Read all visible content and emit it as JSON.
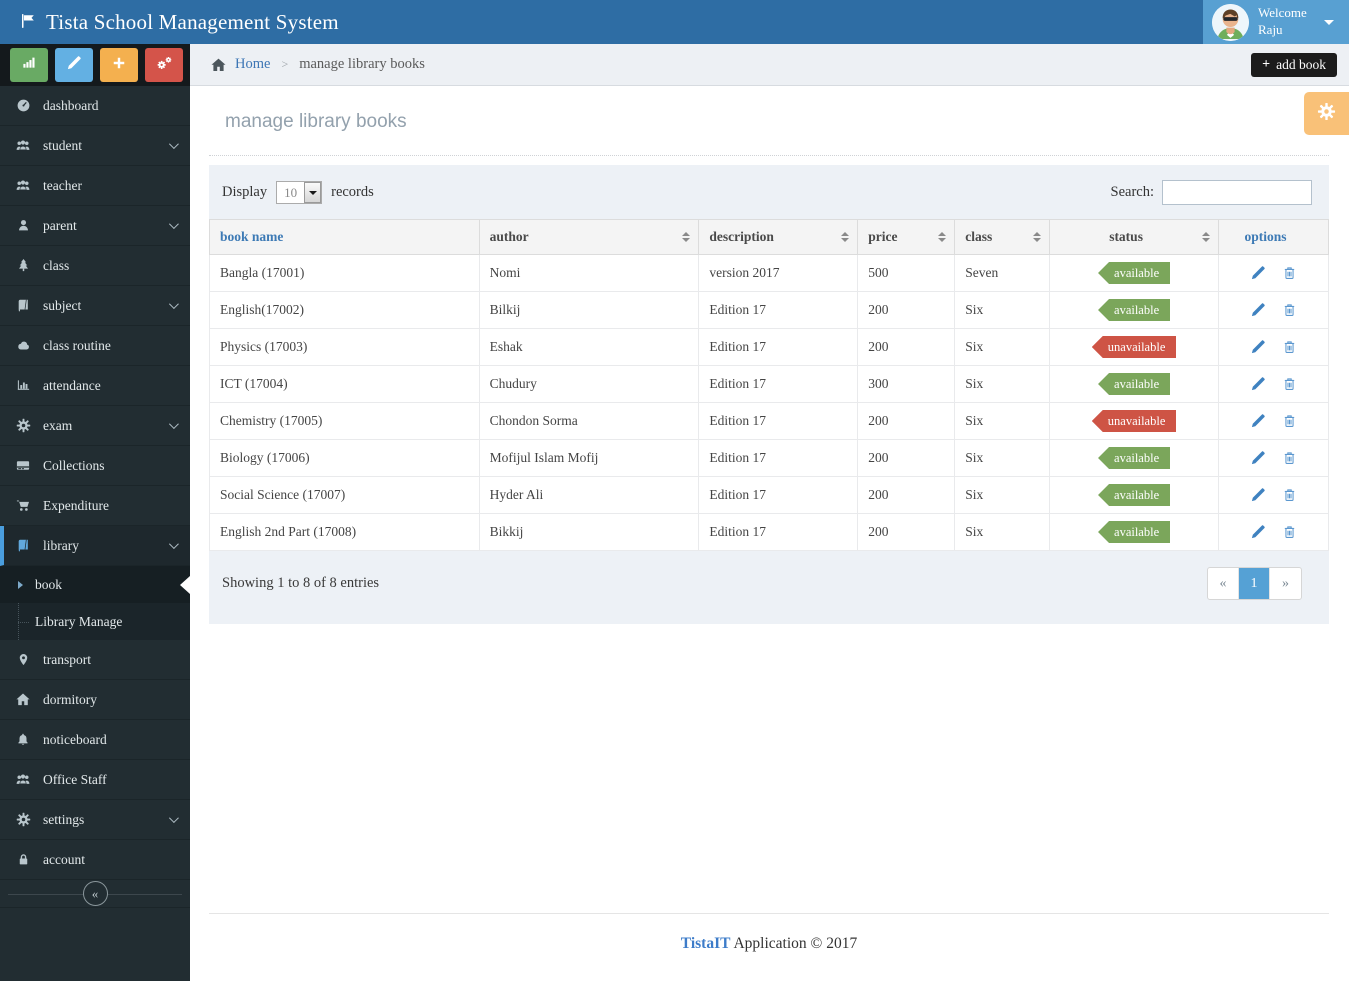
{
  "app": {
    "title": "Tista School Management System",
    "welcome_label": "Welcome",
    "username": "Raju"
  },
  "quickbar": {
    "buttons": [
      {
        "icon": "signal-bars-icon",
        "color": "#69aa64"
      },
      {
        "icon": "pencil-icon",
        "color": "#63b0e3"
      },
      {
        "icon": "plus-icon",
        "color": "#f4b04f"
      },
      {
        "icon": "gears-icon",
        "color": "#d4544a"
      }
    ]
  },
  "breadcrumb": {
    "home": "Home",
    "separator": ">",
    "current": "manage library books"
  },
  "actions": {
    "add_book": "add book",
    "add_book_plus": "+"
  },
  "page": {
    "heading": "manage library books"
  },
  "toolbar": {
    "display_label": "Display",
    "page_size": "10",
    "records_label": "records",
    "search_label": "Search:",
    "search_value": ""
  },
  "table": {
    "columns": [
      {
        "label": "book name",
        "sortable": false,
        "accent": true
      },
      {
        "label": "author",
        "sortable": true,
        "accent": false
      },
      {
        "label": "description",
        "sortable": true,
        "accent": false
      },
      {
        "label": "price",
        "sortable": true,
        "accent": false
      },
      {
        "label": "class",
        "sortable": true,
        "accent": false
      },
      {
        "label": "status",
        "sortable": true,
        "accent": false
      },
      {
        "label": "options",
        "sortable": false,
        "accent": true
      }
    ],
    "rows": [
      {
        "name": "Bangla (17001)",
        "author": "Nomi",
        "description": "version 2017",
        "price": "500",
        "class": "Seven",
        "status": "available"
      },
      {
        "name": "English(17002)",
        "author": "Bilkij",
        "description": "Edition 17",
        "price": "200",
        "class": "Six",
        "status": "available"
      },
      {
        "name": "Physics (17003)",
        "author": "Eshak",
        "description": "Edition 17",
        "price": "200",
        "class": "Six",
        "status": "unavailable"
      },
      {
        "name": "ICT (17004)",
        "author": "Chudury",
        "description": "Edition 17",
        "price": "300",
        "class": "Six",
        "status": "available"
      },
      {
        "name": "Chemistry (17005)",
        "author": "Chondon Sorma",
        "description": "Edition 17",
        "price": "200",
        "class": "Six",
        "status": "unavailable"
      },
      {
        "name": "Biology (17006)",
        "author": "Mofijul Islam Mofij",
        "description": "Edition 17",
        "price": "200",
        "class": "Six",
        "status": "available"
      },
      {
        "name": "Social Science (17007)",
        "author": "Hyder Ali",
        "description": "Edition 17",
        "price": "200",
        "class": "Six",
        "status": "available"
      },
      {
        "name": "English 2nd Part (17008)",
        "author": "Bikkij",
        "description": "Edition 17",
        "price": "200",
        "class": "Six",
        "status": "available"
      }
    ]
  },
  "status_colors": {
    "available": "#7ba65b",
    "unavailable": "#ce5445"
  },
  "table_footer": {
    "summary": "Showing 1 to 8 of 8 entries",
    "pagination": {
      "prev": "«",
      "current": "1",
      "next": "»"
    }
  },
  "footer": {
    "brand": "TistaIT",
    "text": " Application © 2017"
  },
  "sidebar": {
    "items": [
      {
        "label": "dashboard",
        "icon": "dashboard-icon"
      },
      {
        "label": "student",
        "icon": "users-icon"
      },
      {
        "label": "teacher",
        "icon": "users-icon"
      },
      {
        "label": "parent",
        "icon": "user-icon"
      },
      {
        "label": "class",
        "icon": "tree-icon"
      },
      {
        "label": "subject",
        "icon": "book-icon"
      },
      {
        "label": "class routine",
        "icon": "cloud-icon"
      },
      {
        "label": "attendance",
        "icon": "bar-chart-icon"
      },
      {
        "label": "exam",
        "icon": "cog-icon"
      },
      {
        "label": "Collections",
        "icon": "credit-card-icon"
      },
      {
        "label": "Expenditure",
        "icon": "cart-icon"
      },
      {
        "label": "library",
        "icon": "book-icon",
        "active": true
      },
      {
        "label": "transport",
        "icon": "map-pin-icon"
      },
      {
        "label": "dormitory",
        "icon": "home-icon"
      },
      {
        "label": "noticeboard",
        "icon": "bell-icon"
      },
      {
        "label": "Office Staff",
        "icon": "users-icon"
      },
      {
        "label": "settings",
        "icon": "gear-icon"
      },
      {
        "label": "account",
        "icon": "lock-icon"
      }
    ],
    "submenu": [
      {
        "label": "book",
        "active": true
      },
      {
        "label": "Library Manage",
        "active": false
      }
    ],
    "collapse_glyph": "«"
  },
  "colors": {
    "header_blue": "#2e6da4",
    "userbox_blue": "#58a0d2",
    "sidebar_dark": "#222d32",
    "active_accent": "#4a9ede",
    "pager_active": "#55a1d5",
    "gear_fab_orange": "#f9c178",
    "link_blue": "#3d76b5"
  }
}
